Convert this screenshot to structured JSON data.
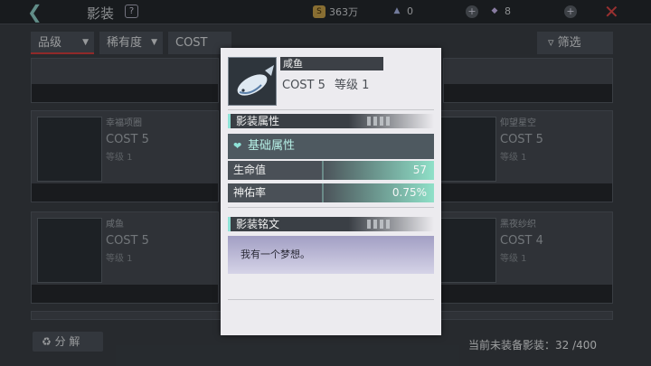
{
  "topbar": {
    "title": "影装",
    "help_icon": "?",
    "gold": "363万",
    "crystal": "0",
    "gem": "8"
  },
  "filters": {
    "quality": "品级",
    "rarity": "稀有度",
    "cost": "COST",
    "sift": "筛选"
  },
  "cards": [
    {
      "name": "幸福项圈",
      "cost": "COST 5",
      "level": "等级 1"
    },
    {
      "name": "咸鱼",
      "cost": "COST 5",
      "level": "等级 1"
    },
    {
      "name": "仰望星空",
      "cost": "COST 5",
      "level": "等级 1"
    },
    {
      "name": "黑夜纱织",
      "cost": "COST 4",
      "level": "等级 1"
    }
  ],
  "bottom": {
    "decompose": "分 解",
    "unequipped": "当前未装备影装：32 /400"
  },
  "popup": {
    "name": "咸鱼",
    "cost": "COST 5",
    "level": "等级 1",
    "attr_section": "影装属性",
    "basic_label": "基础属性",
    "stats": [
      {
        "key": "生命值",
        "value": "57"
      },
      {
        "key": "神佑率",
        "value": "0.75%"
      }
    ],
    "inscription_section": "影装铭文",
    "inscription_text": "我有一个梦想。"
  },
  "colors": {
    "accent": "#8fe3d8",
    "close": "#e04848",
    "active_tab": "#d43d3d"
  }
}
